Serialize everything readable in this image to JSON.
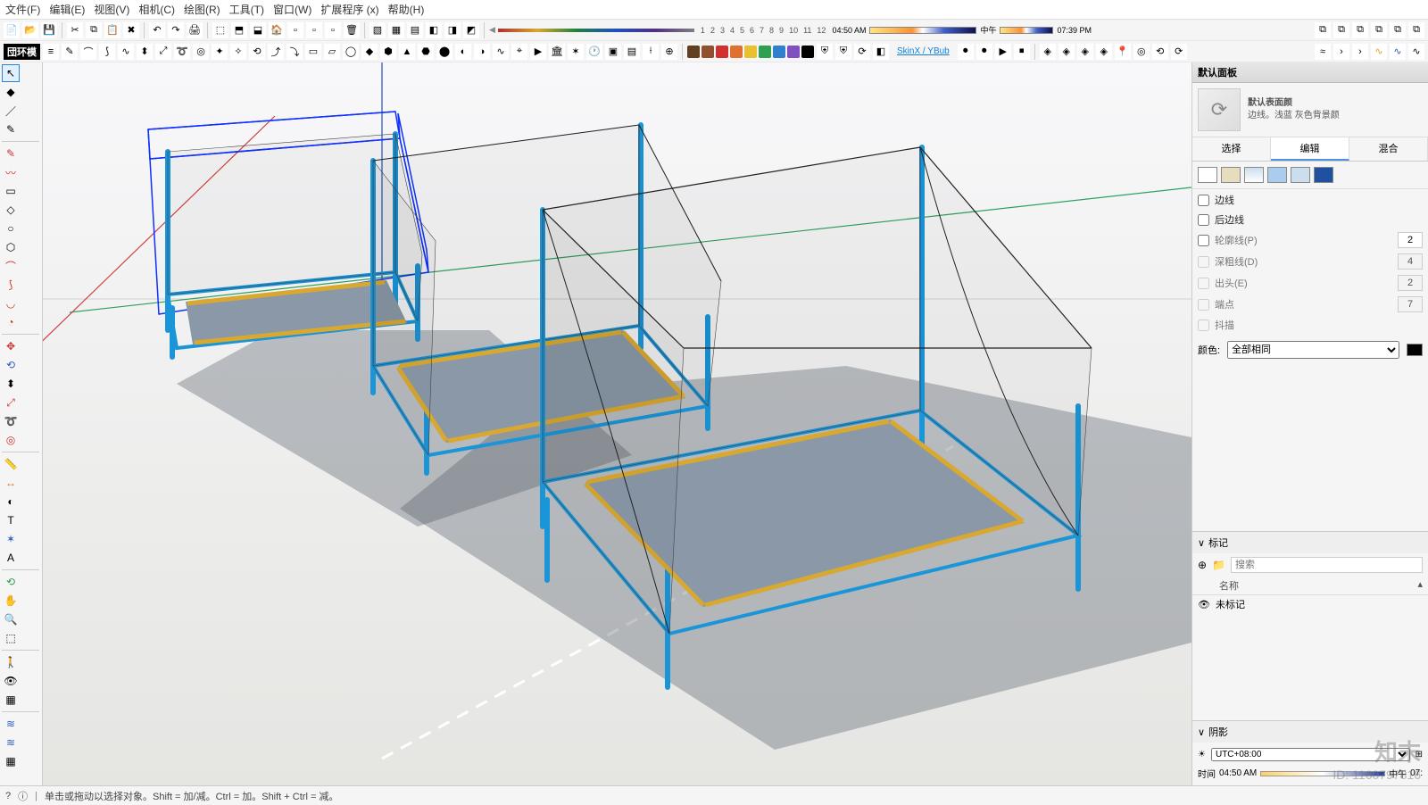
{
  "menu": {
    "file": "文件(F)",
    "edit": "编辑(E)",
    "view": "视图(V)",
    "camera": "相机(C)",
    "draw": "绘图(R)",
    "tools": "工具(T)",
    "window": "窗口(W)",
    "extensions": "扩展程序 (x)",
    "help": "帮助(H)"
  },
  "ruler": [
    "1",
    "2",
    "3",
    "4",
    "5",
    "6",
    "7",
    "8",
    "9",
    "10",
    "11",
    "12"
  ],
  "time_left": "04:50 AM",
  "time_mid": "中午",
  "time_right": "07:39 PM",
  "skinx": "SkinX / YBub",
  "logo": "団环模",
  "panel": {
    "title": "默认面板",
    "default_heading": "默认表面颜",
    "default_desc": "边线。浅蓝\n灰色背景颜",
    "tabs": {
      "select": "选择",
      "edit": "编辑",
      "mix": "混合"
    },
    "checks": {
      "edges": "边线",
      "back": "后边线",
      "profile": "轮廓线(P)",
      "depth": "深粗线(D)",
      "ext": "出头(E)",
      "endp": "端点",
      "jitter": "抖描"
    },
    "profile_val": "2",
    "depth_val": "4",
    "ext_val": "2",
    "endp_val": "7",
    "color_label": "颜色:",
    "color_value": "全部相同",
    "tags_title": "标记",
    "search_ph": "搜索",
    "col_name": "名称",
    "untagged": "未标记",
    "shadows_title": "阴影",
    "tz": "UTC+08:00",
    "s_time": "时间",
    "s_time_left": "04:50 AM",
    "s_time_mid": "中午",
    "s_time_right": "07:"
  },
  "status": {
    "hint": "单击或拖动以选择对象。Shift = 加/减。Ctrl = 加。Shift + Ctrl = 减。"
  },
  "watermark": {
    "brand": "知末",
    "id": "ID: 1160797816"
  }
}
